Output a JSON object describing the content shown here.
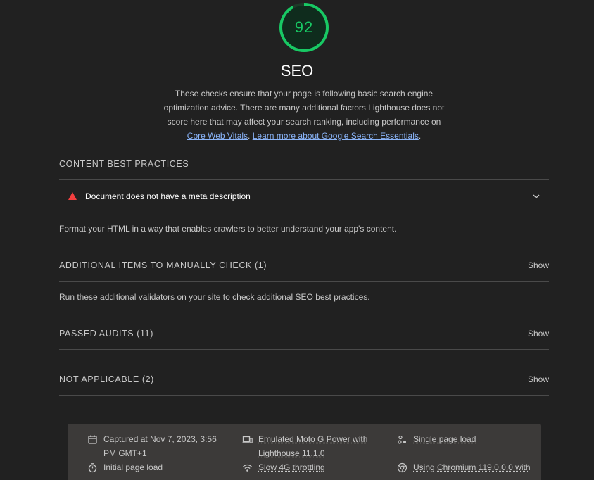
{
  "category": {
    "score": "92",
    "score_fraction": 0.92,
    "score_color": "#18c964",
    "title": "SEO",
    "description_text": "These checks ensure that your page is following basic search engine optimization advice. There are many additional factors Lighthouse does not score here that may affect your search ranking, including performance on",
    "link_core_web_vitals": "Core Web Vitals",
    "separator": ". ",
    "link_learn_more": "Learn more about Google Search Essentials",
    "trailing": "."
  },
  "groups": {
    "content": {
      "title": "CONTENT BEST PRACTICES",
      "audit_title": "Document does not have a meta description",
      "audit_icon": "fail-triangle-icon",
      "description": "Format your HTML in a way that enables crawlers to better understand your app's content."
    },
    "manual": {
      "title": "ADDITIONAL ITEMS TO MANUALLY CHECK (1)",
      "show_label": "Show",
      "description": "Run these additional validators on your site to check additional SEO best practices."
    },
    "passed": {
      "title": "PASSED AUDITS (11)",
      "show_label": "Show"
    },
    "not_applicable": {
      "title": "NOT APPLICABLE (2)",
      "show_label": "Show"
    }
  },
  "footer": {
    "captured_line1": "Captured at Nov 7, 2023, 3:56",
    "captured_line2": "PM GMT+1",
    "initial_load": "Initial page load",
    "emulated_line1": "Emulated Moto G Power with",
    "emulated_line2": "Lighthouse 11.1.0",
    "throttling": "Slow 4G throttling",
    "single_load": "Single page load",
    "chromium": "Using Chromium 119.0.0.0 with"
  },
  "colors": {
    "background": "#212121",
    "fail": "#f33f3f",
    "link": "#8ab4f8",
    "footer_bg": "#3c3a39"
  }
}
